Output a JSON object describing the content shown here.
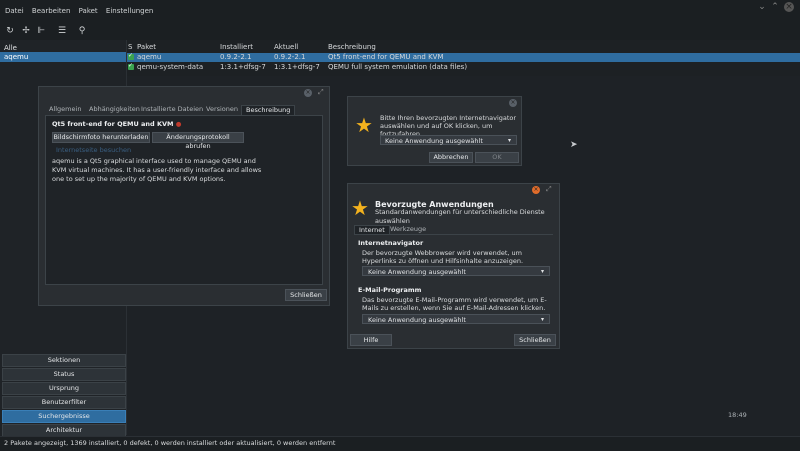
{
  "menu": [
    "Datei",
    "Bearbeiten",
    "Paket",
    "Einstellungen"
  ],
  "toolbar": {
    "icons": [
      "refresh-icon",
      "mark-upgrade-icon",
      "tree-icon",
      "menu-icon",
      "search-icon"
    ]
  },
  "left": {
    "header": "Alle",
    "selected": "aqemu",
    "buttons": [
      "Sektionen",
      "Status",
      "Ursprung",
      "Benutzerfilter",
      "Suchergebnisse",
      "Architektur"
    ],
    "active_button": "Suchergebnisse"
  },
  "table": {
    "headers": [
      "S",
      "Paket",
      "Installiert",
      "Aktuell",
      "Beschreibung"
    ],
    "rows": [
      {
        "name": "aqemu",
        "installed": "0.9.2-2.1",
        "current": "0.9.2-2.1",
        "desc": "Qt5 front-end for QEMU and KVM"
      },
      {
        "name": "qemu-system-data",
        "installed": "1:3.1+dfsg-7",
        "current": "1:3.1+dfsg-7",
        "desc": "QEMU full system emulation (data files)"
      }
    ]
  },
  "details": {
    "tabs": [
      "Allgemein",
      "Abhängigkeiten",
      "Installierte Dateien",
      "Versionen",
      "Beschreibung"
    ],
    "active_tab": "Beschreibung",
    "title": "Qt5 front-end for QEMU and KVM",
    "btn_screenshot": "Bildschirmfoto herunterladen",
    "btn_changelog": "Änderungsprotokoll abrufen",
    "link": "Internetseite besuchen",
    "description": "aqemu is a Qt5 graphical interface used to manage QEMU and KVM virtual machines. It has a user-friendly interface and allows one to set up the majority of QEMU and KVM options.",
    "close": "Schließen"
  },
  "browser_dialog": {
    "text": "Bitte Ihren bevorzugten Internetnavigator auswählen und auf OK klicken, um fortzufahren.",
    "combo": "Keine Anwendung ausgewählt",
    "cancel": "Abbrechen",
    "ok": "OK"
  },
  "apps_dialog": {
    "title": "Bevorzugte Anwendungen",
    "subtitle": "Standardanwendungen für unterschiedliche Dienste auswählen",
    "tabs": [
      "Internet",
      "Werkzeuge"
    ],
    "active_tab": "Internet",
    "browser_heading": "Internetnavigator",
    "browser_text": "Der bevorzugte Webbrowser wird verwendet, um Hyperlinks zu öffnen und Hilfsinhalte anzuzeigen.",
    "browser_combo": "Keine Anwendung ausgewählt",
    "email_heading": "E-Mail-Programm",
    "email_text": "Das bevorzugte E-Mail-Programm wird verwendet, um E-Mails zu erstellen, wenn Sie auf E-Mail-Adressen klicken.",
    "email_combo": "Keine Anwendung ausgewählt",
    "help": "Hilfe",
    "close": "Schließen"
  },
  "clock": "18:49",
  "status": "2 Pakete angezeigt, 1369 installiert, 0 defekt, 0 werden installiert oder aktualisiert, 0 werden entfernt",
  "colors": {
    "accent": "#2f6da0",
    "star": "#f3b21e",
    "check": "#3aa34f",
    "close": "#e06c2b"
  }
}
